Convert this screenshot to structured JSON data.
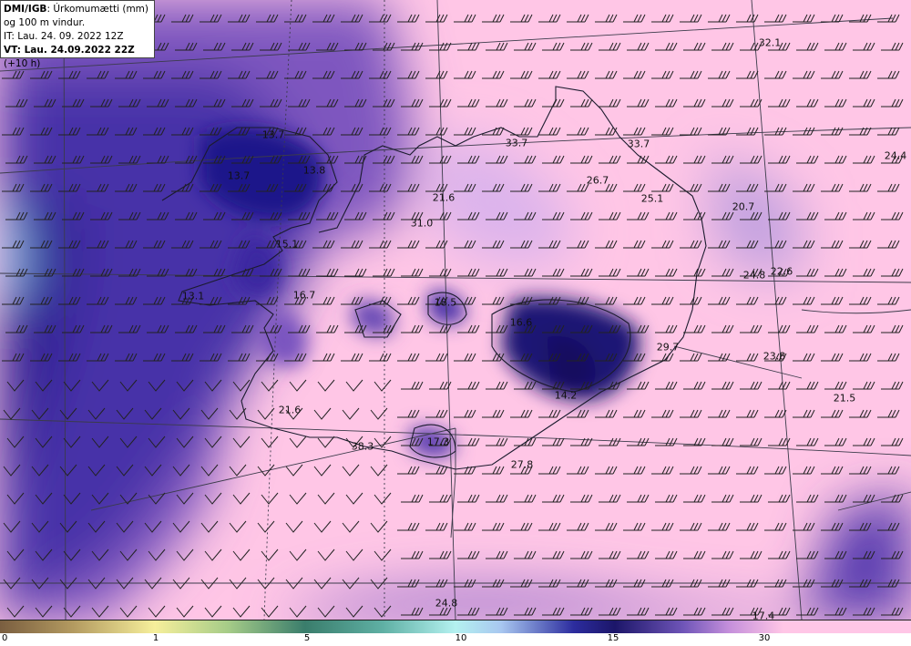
{
  "header": {
    "source": "DMI/IGB",
    "title_rest": ": Úrkomumætti (mm)",
    "line2": "og 100 m vindur.",
    "it_line": "IT: Lau. 24. 09. 2022 12Z",
    "vt_bold": "VT: Lau. 24.09.2022 22Z",
    "vt_rest": " (+10 h)"
  },
  "colorbar": {
    "ticks": [
      "0",
      "1",
      "5",
      "10",
      "15",
      "30"
    ]
  },
  "labels": [
    "32.1",
    "24.4",
    "33.7",
    "33.7",
    "13.7",
    "13.7",
    "13.8",
    "26.7",
    "25.1",
    "21.6",
    "20.7",
    "31.0",
    "15.1",
    "24.8",
    "22.6",
    "13.1",
    "16.7",
    "18.5",
    "16.6",
    "29.7",
    "23.8",
    "14.2",
    "21.5",
    "21.6",
    "17.3",
    "38.3",
    "27.8",
    "24.8",
    "17.4"
  ],
  "colors": {
    "pink": "#ffc6e6",
    "purple": "#8f63c7",
    "deep": "#2e1f8e",
    "navy": "#1c1669"
  }
}
